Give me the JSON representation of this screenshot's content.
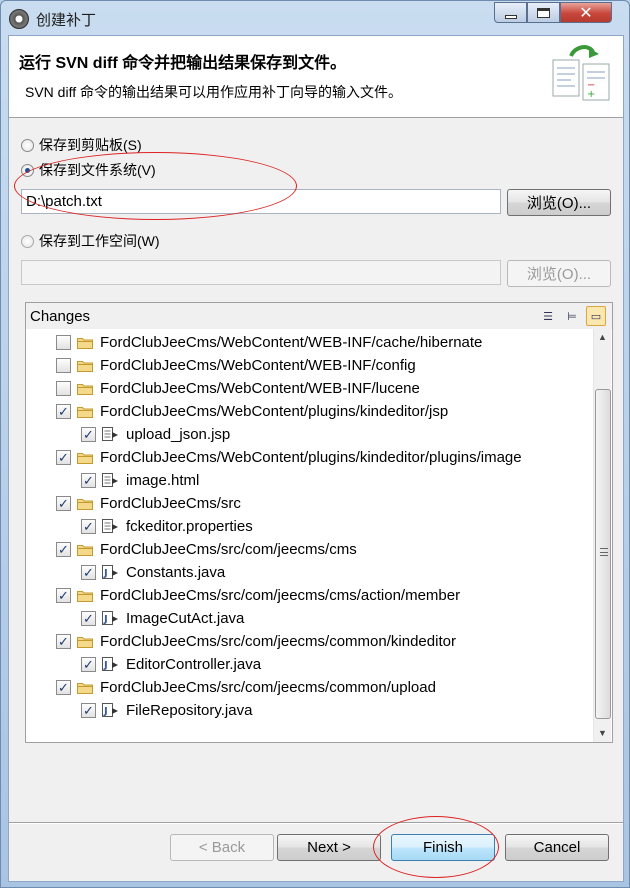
{
  "window": {
    "title": "创建补丁"
  },
  "banner": {
    "title": "运行 SVN diff 命令并把输出结果保存到文件。",
    "description": "SVN diff 命令的输出结果可以用作应用补丁向导的输入文件。"
  },
  "options": {
    "clipboard_label": "保存到剪贴板(S)",
    "filesystem_label": "保存到文件系统(V)",
    "filesystem_path": "D:\\patch.txt",
    "browse_label": "浏览(O)...",
    "workspace_label": "保存到工作空间(W)",
    "workspace_path": "",
    "workspace_browse_label": "浏览(O)..."
  },
  "changes": {
    "label": "Changes",
    "items": [
      {
        "level": 0,
        "kind": "folder",
        "checked": false,
        "label": "FordClubJeeCms/WebContent/WEB-INF/cache/hibernate"
      },
      {
        "level": 0,
        "kind": "folder",
        "checked": false,
        "label": "FordClubJeeCms/WebContent/WEB-INF/config"
      },
      {
        "level": 0,
        "kind": "folder",
        "checked": false,
        "label": "FordClubJeeCms/WebContent/WEB-INF/lucene"
      },
      {
        "level": 0,
        "kind": "folder",
        "checked": true,
        "label": "FordClubJeeCms/WebContent/plugins/kindeditor/jsp"
      },
      {
        "level": 1,
        "kind": "file",
        "checked": true,
        "label": "upload_json.jsp"
      },
      {
        "level": 0,
        "kind": "folder",
        "checked": true,
        "label": "FordClubJeeCms/WebContent/plugins/kindeditor/plugins/image"
      },
      {
        "level": 1,
        "kind": "file",
        "checked": true,
        "label": "image.html"
      },
      {
        "level": 0,
        "kind": "folder",
        "checked": true,
        "label": "FordClubJeeCms/src"
      },
      {
        "level": 1,
        "kind": "file",
        "checked": true,
        "label": "fckeditor.properties"
      },
      {
        "level": 0,
        "kind": "folder",
        "checked": true,
        "label": "FordClubJeeCms/src/com/jeecms/cms"
      },
      {
        "level": 1,
        "kind": "java",
        "checked": true,
        "label": "Constants.java"
      },
      {
        "level": 0,
        "kind": "folder",
        "checked": true,
        "label": "FordClubJeeCms/src/com/jeecms/cms/action/member"
      },
      {
        "level": 1,
        "kind": "java",
        "checked": true,
        "label": "ImageCutAct.java"
      },
      {
        "level": 0,
        "kind": "folder",
        "checked": true,
        "label": "FordClubJeeCms/src/com/jeecms/common/kindeditor"
      },
      {
        "level": 1,
        "kind": "java",
        "checked": true,
        "label": "EditorController.java"
      },
      {
        "level": 0,
        "kind": "folder",
        "checked": true,
        "label": "FordClubJeeCms/src/com/jeecms/common/upload"
      },
      {
        "level": 1,
        "kind": "java",
        "checked": true,
        "label": "FileRepository.java"
      }
    ]
  },
  "buttons": {
    "back": "< Back",
    "next": "Next >",
    "finish": "Finish",
    "cancel": "Cancel"
  },
  "colors": {
    "annotation": "#dd2222",
    "accent": "#1d4f91"
  }
}
